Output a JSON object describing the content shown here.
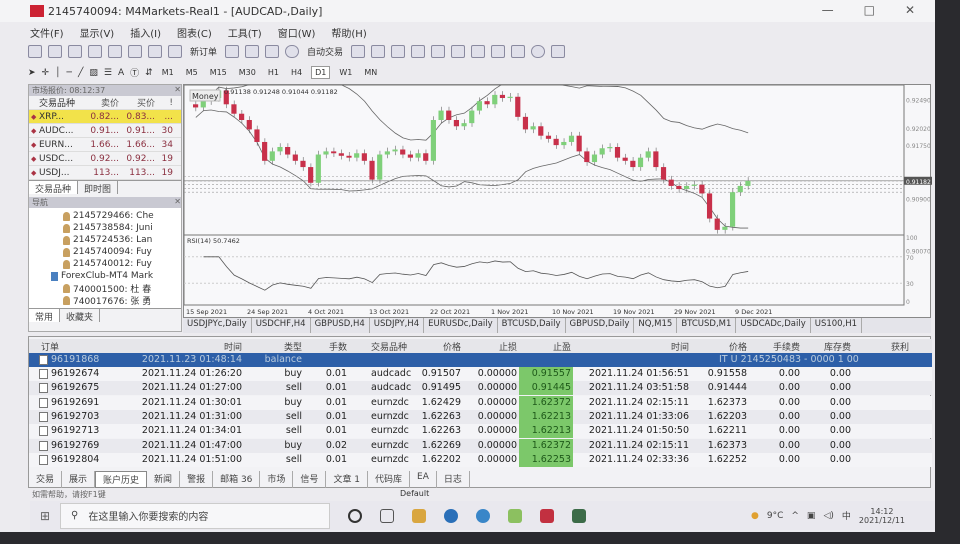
{
  "window": {
    "title": "2145740094: M4Markets-Real1 - [AUDCAD-,Daily]",
    "minimize": "—",
    "maximize": "□",
    "close": "✕"
  },
  "menu": [
    "文件(F)",
    "显示(V)",
    "插入(I)",
    "图表(C)",
    "工具(T)",
    "窗口(W)",
    "帮助(H)"
  ],
  "toolbar": {
    "new_order": "新订单",
    "auto_trade": "自动交易",
    "text_tool": "A",
    "timeframes": [
      "M1",
      "M5",
      "M15",
      "M30",
      "H1",
      "H4",
      "D1",
      "W1",
      "MN"
    ]
  },
  "market_watch": {
    "title": "市场报价: 08:12:37",
    "columns": [
      "交易品种",
      "卖价",
      "买价",
      "!"
    ],
    "rows": [
      {
        "symbol": "XRP...",
        "bid": "0.82...",
        "ask": "0.83...",
        "spread": "..."
      },
      {
        "symbol": "AUDC...",
        "bid": "0.91...",
        "ask": "0.91...",
        "spread": "30"
      },
      {
        "symbol": "EURN...",
        "bid": "1.66...",
        "ask": "1.66...",
        "spread": "34"
      },
      {
        "symbol": "USDC...",
        "bid": "0.92...",
        "ask": "0.92...",
        "spread": "19"
      },
      {
        "symbol": "USDJ...",
        "bid": "113...",
        "ask": "113...",
        "spread": "19"
      }
    ],
    "tabs": [
      "交易品种",
      "即时图"
    ]
  },
  "navigator": {
    "title": "导航",
    "items": [
      "2145729466: Che",
      "2145738584: Juni",
      "2145724536: Lan",
      "2145740094: Fuy",
      "2145740012: Fuy",
      "ForexClub-MT4 Mark",
      "740001500: 杜 春",
      "740017676: 张 勇"
    ],
    "tabs": [
      "常用",
      "收藏夹"
    ]
  },
  "chart": {
    "ohlc_label": "0.91138 0.91248 0.91044 0.91182",
    "money_label": "Money",
    "current_price": "0.91182",
    "price_axis": [
      "0.92490",
      "0.92020",
      "0.91750",
      "0.90900",
      "0.90070"
    ],
    "rsi_label": "RSI(14) 50.7462",
    "rsi_axis": [
      "100",
      "70",
      "30",
      "0"
    ],
    "dates": [
      "15 Sep 2021",
      "24 Sep 2021",
      "4 Oct 2021",
      "13 Oct 2021",
      "22 Oct 2021",
      "1 Nov 2021",
      "10 Nov 2021",
      "19 Nov 2021",
      "29 Nov 2021",
      "9 Dec 2021"
    ],
    "closes": [
      0.9235,
      0.9245,
      0.925,
      0.9262,
      0.924,
      0.9225,
      0.9215,
      0.92,
      0.918,
      0.915,
      0.9165,
      0.9172,
      0.916,
      0.915,
      0.914,
      0.9115,
      0.916,
      0.9165,
      0.9162,
      0.9158,
      0.9155,
      0.9162,
      0.915,
      0.912,
      0.916,
      0.9165,
      0.9168,
      0.916,
      0.9155,
      0.9162,
      0.915,
      0.9215,
      0.923,
      0.9215,
      0.9205,
      0.921,
      0.923,
      0.9245,
      0.924,
      0.9255,
      0.925,
      0.9252,
      0.922,
      0.92,
      0.9205,
      0.919,
      0.9185,
      0.9175,
      0.918,
      0.919,
      0.9165,
      0.9148,
      0.916,
      0.917,
      0.9172,
      0.9155,
      0.915,
      0.914,
      0.9155,
      0.9165,
      0.914,
      0.912,
      0.911,
      0.9105,
      0.911,
      0.9112,
      0.9098,
      0.9058,
      0.904,
      0.9045,
      0.91,
      0.911,
      0.9118
    ],
    "price_range": [
      0.9035,
      0.9258
    ],
    "up_color": "#7fd07a",
    "down_color": "#c8304a"
  },
  "chart_tabs": [
    "USDJPYc,Daily",
    "USDCHF,H4",
    "GBPUSD,H4",
    "USDJPY,H4",
    "EURUSDc,Daily",
    "BTCUSD,Daily",
    "GBPUSD,Daily",
    "NQ,M15",
    "BTCUSD,M1",
    "USDCADc,Daily",
    "US100,H1"
  ],
  "terminal": {
    "columns": [
      "订单",
      "时间",
      "类型",
      "手数",
      "交易品种",
      "价格",
      "止损",
      "止盈",
      "时间",
      "价格",
      "手续费",
      "库存费",
      "获利"
    ],
    "balance_row": {
      "order": "96191868",
      "time": "2021.11.23 01:48:14",
      "type": "balance",
      "comment": "IT U 2145250483 - 0000 1 00"
    },
    "rows": [
      [
        "96192674",
        "2021.11.24 01:26:20",
        "buy",
        "0.01",
        "audcadc",
        "0.91507",
        "0.00000",
        "0.91557",
        "2021.11.24 01:56:51",
        "0.91558",
        "0.00",
        "0.00"
      ],
      [
        "96192675",
        "2021.11.24 01:27:00",
        "sell",
        "0.01",
        "audcadc",
        "0.91495",
        "0.00000",
        "0.91445",
        "2021.11.24 03:51:58",
        "0.91444",
        "0.00",
        "0.00"
      ],
      [
        "96192691",
        "2021.11.24 01:30:01",
        "buy",
        "0.01",
        "eurnzdc",
        "1.62429",
        "0.00000",
        "1.62372",
        "2021.11.24 02:15:11",
        "1.62373",
        "0.00",
        "0.00"
      ],
      [
        "96192703",
        "2021.11.24 01:31:00",
        "sell",
        "0.01",
        "eurnzdc",
        "1.62263",
        "0.00000",
        "1.62213",
        "2021.11.24 01:33:06",
        "1.62203",
        "0.00",
        "0.00"
      ],
      [
        "96192713",
        "2021.11.24 01:34:01",
        "sell",
        "0.01",
        "eurnzdc",
        "1.62263",
        "0.00000",
        "1.62213",
        "2021.11.24 01:50:50",
        "1.62211",
        "0.00",
        "0.00"
      ],
      [
        "96192769",
        "2021.11.24 01:47:00",
        "buy",
        "0.02",
        "eurnzdc",
        "1.62269",
        "0.00000",
        "1.62372",
        "2021.11.24 02:15:11",
        "1.62373",
        "0.00",
        "0.00"
      ],
      [
        "96192804",
        "2021.11.24 01:51:00",
        "sell",
        "0.01",
        "eurnzdc",
        "1.62202",
        "0.00000",
        "1.62253",
        "2021.11.24 02:33:36",
        "1.62252",
        "0.00",
        "0.00"
      ]
    ],
    "tabs": [
      "交易",
      "展示",
      "账户历史",
      "新闻",
      "警报",
      "邮箱 36",
      "市场",
      "信号",
      "文章 1",
      "代码库",
      "EA",
      "日志"
    ]
  },
  "status": {
    "help": "如需帮助，请按F1键",
    "profile": "Default"
  },
  "taskbar": {
    "search_placeholder": "在这里输入你要搜索的内容",
    "weather": "9°C",
    "ime": "中",
    "time": "14:12",
    "date": "2021/12/11"
  }
}
